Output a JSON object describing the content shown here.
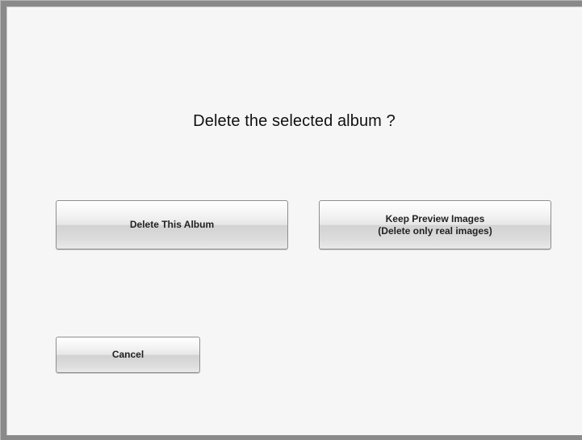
{
  "dialog": {
    "prompt": "Delete the selected album ?",
    "delete_button_label": "Delete This Album",
    "keep_button_line1": "Keep Preview Images",
    "keep_button_line2": "(Delete only real images)",
    "cancel_button_label": "Cancel"
  },
  "colors": {
    "background": "#f6f6f7",
    "frame": "#8a8a8a",
    "text": "#111111"
  }
}
